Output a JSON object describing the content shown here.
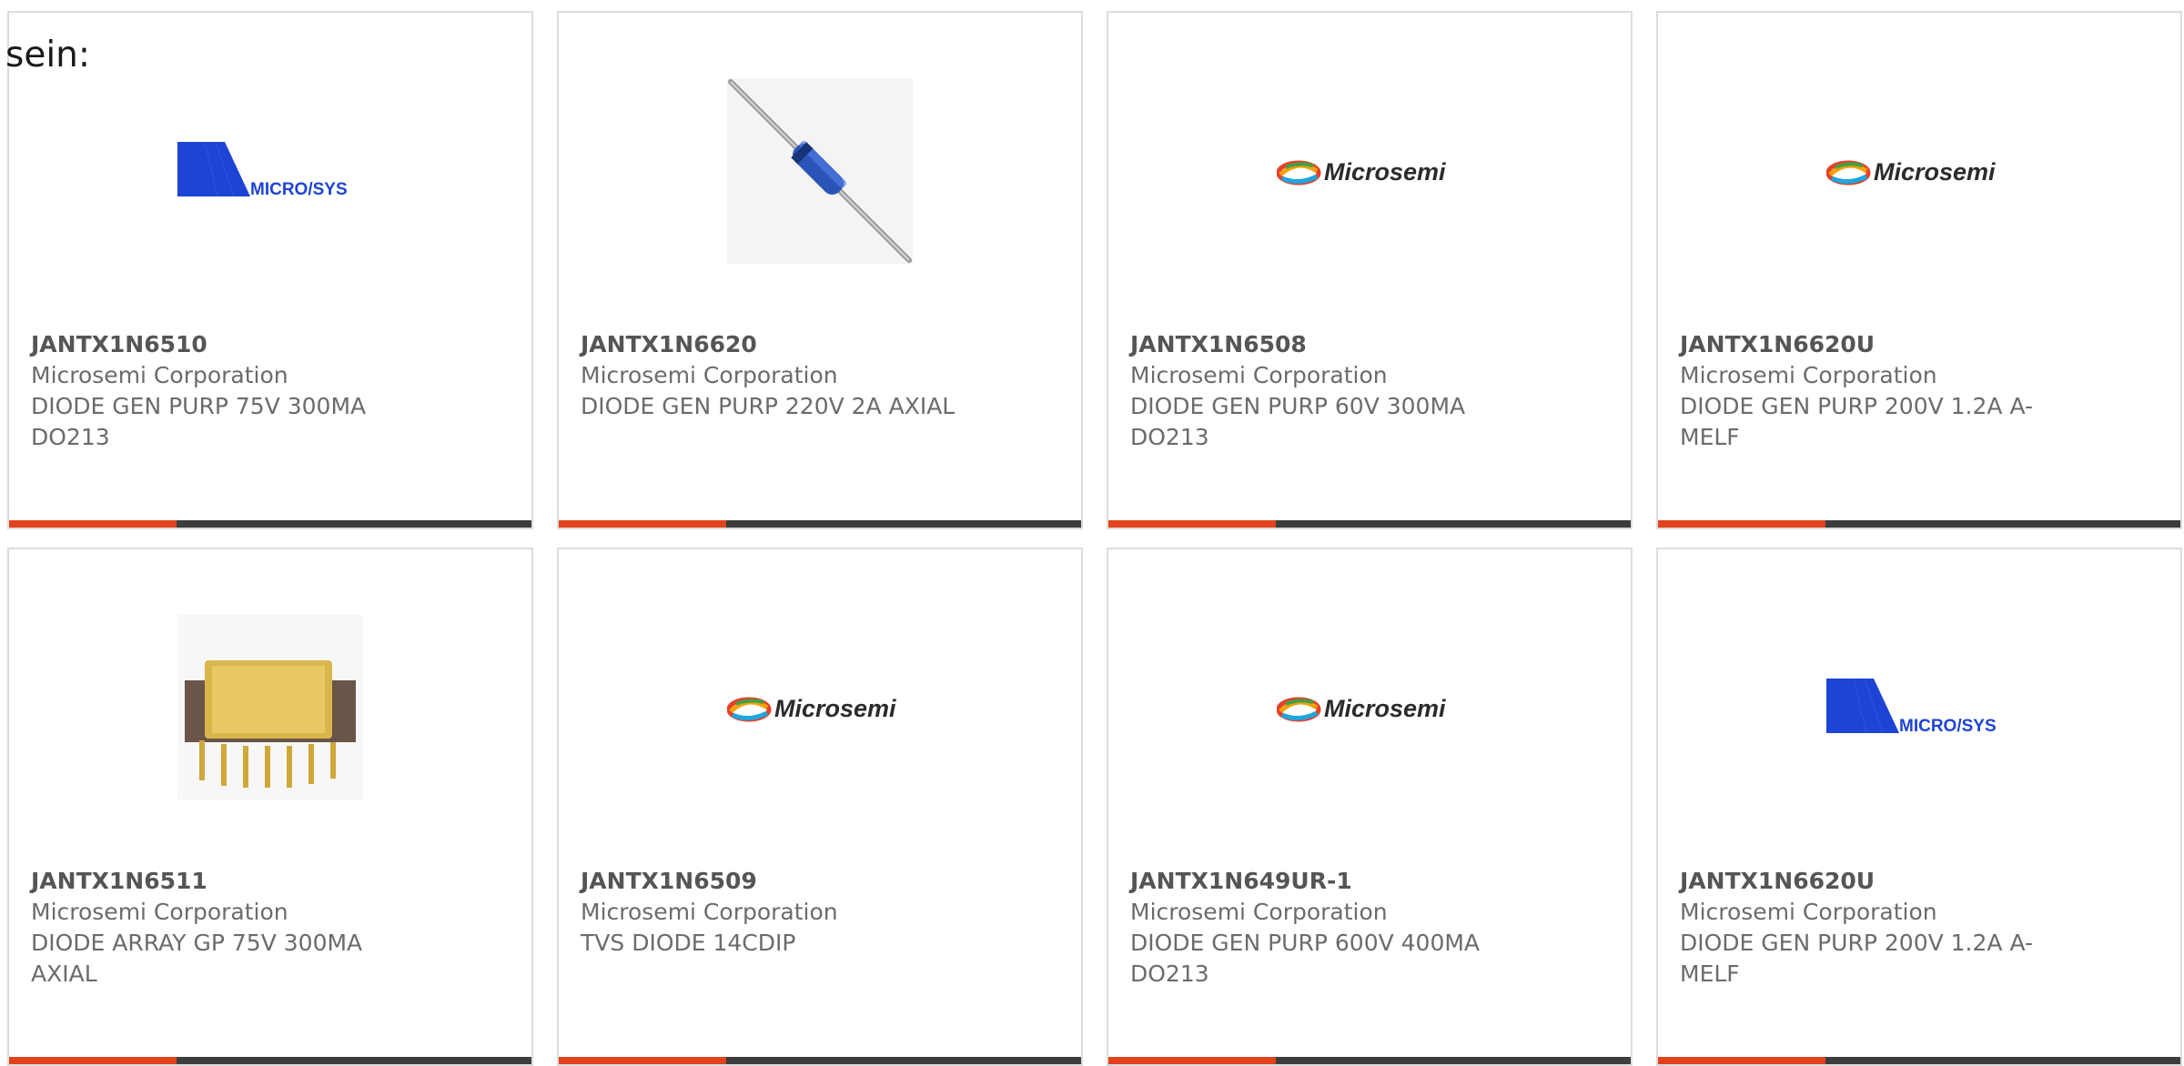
{
  "page": {
    "intro_text": "sein:"
  },
  "colors": {
    "accent": "#e2431c",
    "bar_dark": "#3d3d3d",
    "microsys_blue": "#1d44d4"
  },
  "products": [
    {
      "part_number": "JANTX1N6510",
      "manufacturer": "Microsemi Corporation",
      "description": "DIODE GEN PURP 75V 300MA DO213",
      "image": "microsys-logo",
      "logo_text": "MICRO/SYS"
    },
    {
      "part_number": "JANTX1N6620",
      "manufacturer": "Microsemi Corporation",
      "description": "DIODE GEN PURP 220V 2A AXIAL",
      "image": "axial-diode-photo"
    },
    {
      "part_number": "JANTX1N6508",
      "manufacturer": "Microsemi Corporation",
      "description": "DIODE GEN PURP 60V 300MA DO213",
      "image": "microsemi-logo",
      "logo_text": "Microsemi"
    },
    {
      "part_number": "JANTX1N6620U",
      "manufacturer": "Microsemi Corporation",
      "description": "DIODE GEN PURP 200V 1.2A A-MELF",
      "image": "microsemi-logo",
      "logo_text": "Microsemi"
    },
    {
      "part_number": "JANTX1N6511",
      "manufacturer": "Microsemi Corporation",
      "description": "DIODE ARRAY GP 75V 300MA AXIAL",
      "image": "dip-package-photo"
    },
    {
      "part_number": "JANTX1N6509",
      "manufacturer": "Microsemi Corporation",
      "description": "TVS DIODE 14CDIP",
      "image": "microsemi-logo",
      "logo_text": "Microsemi"
    },
    {
      "part_number": "JANTX1N649UR-1",
      "manufacturer": "Microsemi Corporation",
      "description": "DIODE GEN PURP 600V 400MA DO213",
      "image": "microsemi-logo",
      "logo_text": "Microsemi"
    },
    {
      "part_number": "JANTX1N6620U",
      "manufacturer": "Microsemi Corporation",
      "description": "DIODE GEN PURP 200V 1.2A A-MELF",
      "image": "microsys-logo",
      "logo_text": "MICRO/SYS"
    }
  ]
}
